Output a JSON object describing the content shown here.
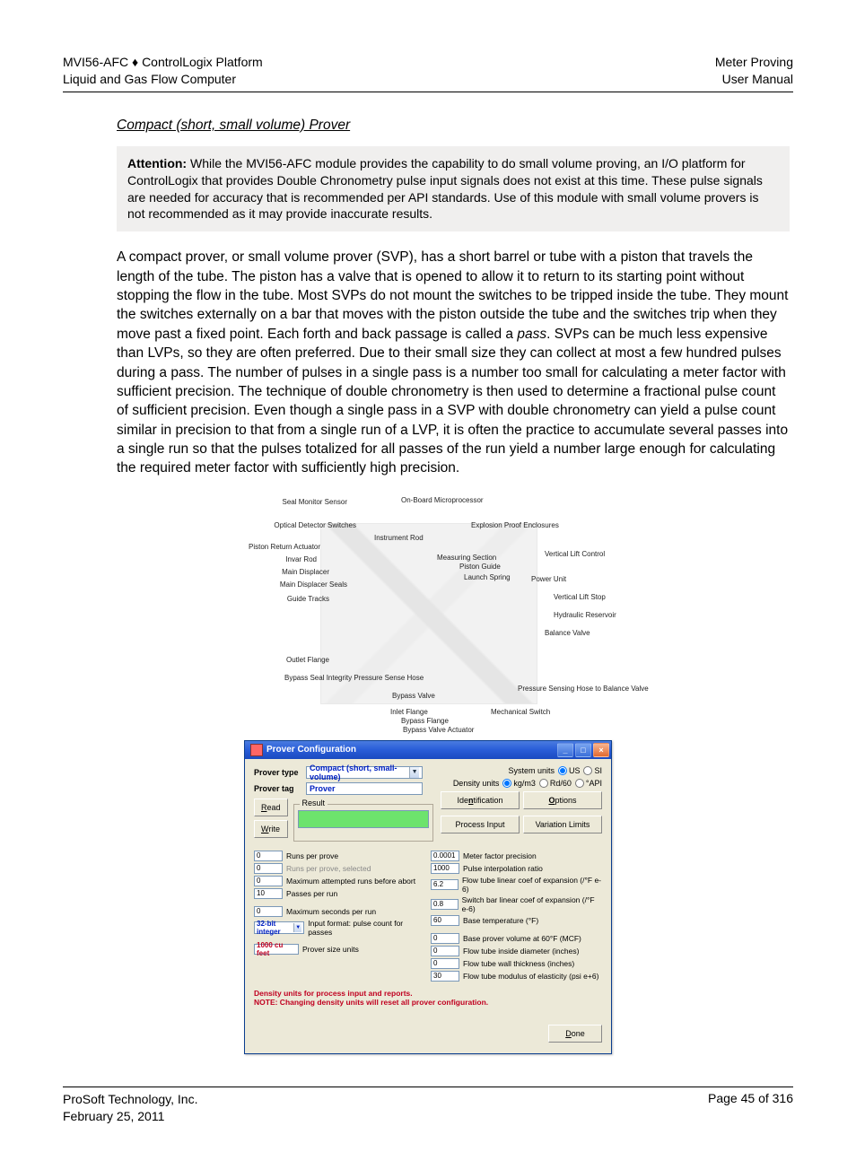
{
  "header": {
    "product": "MVI56-AFC",
    "platform": "ControlLogix Platform",
    "subtitle": "Liquid and Gas Flow Computer",
    "section": "Meter Proving",
    "doc_type": "User Manual"
  },
  "section": {
    "title": "Compact (short, small volume) Prover"
  },
  "attention": {
    "label": "Attention:",
    "text": " While the MVI56-AFC module provides the capability to do small volume proving, an I/O platform for ControlLogix that provides Double Chronometry pulse input signals does not exist at this time. These pulse signals are needed for accuracy that is recommended per API standards. Use of this module with small volume provers is not recommended as it may provide inaccurate results."
  },
  "body": {
    "p1_a": "A compact prover, or small volume prover (SVP), has a short barrel or tube with a piston that travels the length of the tube. The piston has a valve that is opened to allow it to return to its starting point without stopping the flow in the tube. Most SVPs do not mount the switches to be tripped inside the tube. They mount the switches externally on a bar that moves with the piston outside the tube and the switches trip when they move past a fixed point. Each forth and back passage is called a ",
    "pass_word": "pass",
    "p1_b": ". SVPs can be much less expensive than LVPs, so they are often preferred. Due to their small size they can collect at most a few hundred pulses during a pass. The number of pulses in a single pass is a number too small for calculating a meter factor with sufficient precision. The technique of double chronometry is then used to determine a fractional pulse count of sufficient precision. Even though a single pass in a SVP with double chronometry can yield a pulse count similar in precision to that from a single run of a LVP, it is often the practice to accumulate several passes into a single run so that the pulses totalized for all passes of the run yield a number large enough for calculating the required meter factor with sufficiently high precision."
  },
  "diagram": {
    "labels": [
      "Seal Monitor Sensor",
      "On-Board Microprocessor",
      "Optical Detector Switches",
      "Instrument Rod",
      "Explosion Proof Enclosures",
      "Piston Return Actuator",
      "Invar Rod",
      "Measuring Section",
      "Piston Guide",
      "Vertical Lift Control",
      "Main Displacer",
      "Launch Spring",
      "Power Unit",
      "Main Displacer Seals",
      "Vertical Lift Stop",
      "Guide Tracks",
      "Hydraulic Reservoir",
      "Balance Valve",
      "Outlet Flange",
      "Bypass Seal Integrity Pressure Sense Hose",
      "Bypass Valve",
      "Inlet Flange",
      "Bypass Flange",
      "Bypass Valve Actuator",
      "Mechanical Switch",
      "Pressure Sensing Hose to Balance Valve"
    ]
  },
  "dialog": {
    "title": "Prover Configuration",
    "labels": {
      "prover_type": "Prover type",
      "prover_tag": "Prover tag",
      "result": "Result",
      "system_units": "System units",
      "density_units": "Density units"
    },
    "values": {
      "prover_type": "Compact (short, small-volume)",
      "prover_tag": "Prover"
    },
    "buttons": {
      "read_tail": "ead",
      "write_tail": "rite",
      "done_tail": "one"
    },
    "units": {
      "us": "US",
      "si": "SI",
      "kgm3": "kg/m3",
      "rd60": "Rd/60",
      "api": "°API"
    },
    "tabs": {
      "identification": "Identification",
      "options": "Options",
      "process_input": "Process Input",
      "variation_limits": "Variation Limits"
    },
    "params": {
      "left": [
        {
          "val": "0",
          "lbl": "Runs per prove"
        },
        {
          "val": "0",
          "lbl": "Runs per prove, selected"
        },
        {
          "val": "0",
          "lbl": "Maximum attempted runs before abort"
        },
        {
          "val": "10",
          "lbl": "Passes per run"
        },
        {
          "val": "0",
          "lbl": "Maximum seconds per run"
        },
        {
          "val": "32-bit integer",
          "lbl": "Input format: pulse count for passes"
        },
        {
          "val": "1000 cu feet",
          "lbl": "Prover size units"
        }
      ],
      "right": [
        {
          "val": "0.0001",
          "lbl": "Meter factor precision"
        },
        {
          "val": "1000",
          "lbl": "Pulse interpolation ratio"
        },
        {
          "val": "6.2",
          "lbl": "Flow tube linear coef of expansion (/°F e-6)"
        },
        {
          "val": "0.8",
          "lbl": "Switch bar linear coef of expansion (/°F e-6)"
        },
        {
          "val": "60",
          "lbl": "Base temperature (°F)"
        },
        {
          "val": "0",
          "lbl": "Base prover volume at 60°F (MCF)"
        },
        {
          "val": "0",
          "lbl": "Flow tube inside diameter (inches)"
        },
        {
          "val": "0",
          "lbl": "Flow tube wall thickness (inches)"
        },
        {
          "val": "30",
          "lbl": "Flow tube modulus of elasticity (psi e+6)"
        }
      ]
    },
    "note": {
      "line1": "Density units for process input and reports.",
      "line2": "NOTE: Changing density units will reset all prover configuration."
    }
  },
  "footer": {
    "company": "ProSoft Technology, Inc.",
    "date": "February 25, 2011",
    "page": "Page 45 of 316"
  }
}
